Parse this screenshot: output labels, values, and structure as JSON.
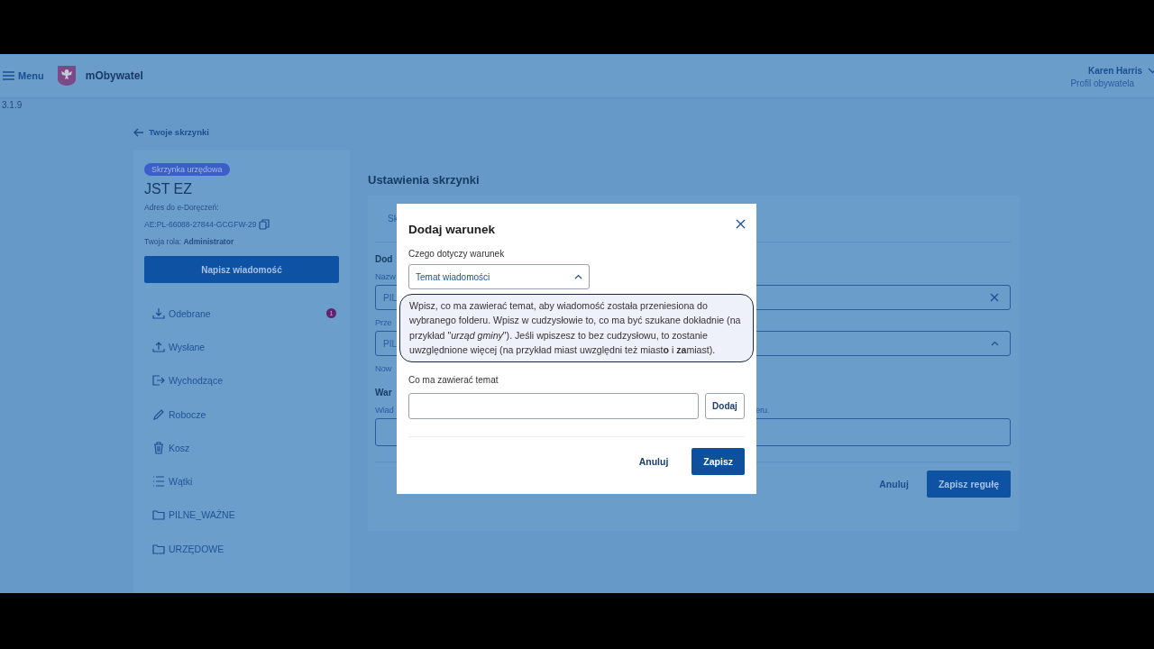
{
  "header": {
    "menu": "Menu",
    "app_name": "mObywatel",
    "user_name": "Karen Harris",
    "profile": "Profil obywatela"
  },
  "version": "3.1.9",
  "back_link": "Twoje skrzynki",
  "mailbox": {
    "badge": "Skrzynka urzędowa",
    "name": "JST EZ",
    "address_label": "Adres do e-Doręczeń:",
    "address": "AE:PL-66088-27844-GCGFW-29",
    "role": "Twoja rola: **Administrator**",
    "compose": "Napisz wiadomość"
  },
  "folders": [
    {
      "label": "Odebrane",
      "kind": "inbox",
      "count": "1"
    },
    {
      "label": "Wysłane",
      "kind": "sent"
    },
    {
      "label": "Wychodzące",
      "kind": "outbox"
    },
    {
      "label": "Robocze",
      "kind": "drafts"
    },
    {
      "label": "Kosz",
      "kind": "trash"
    },
    {
      "label": "Wątki",
      "kind": "threads"
    },
    {
      "label": "PILNE_WAŻNE",
      "kind": "folder"
    },
    {
      "label": "URZĘDOWE",
      "kind": "folder"
    }
  ],
  "settings": {
    "title": "Ustawienia skrzynki",
    "tab": "Sk",
    "section_1": "Dod",
    "name_label": "Nazw",
    "name_value": "PIL",
    "target_label": "Prze",
    "target_value": "PIL",
    "hint": "Now",
    "section_2": "War",
    "desc_start": "Wiad",
    "desc_end": "eru.",
    "cancel": "Anuluj",
    "save": "Zapisz regułę"
  },
  "dialog": {
    "title": "Dodaj warunek",
    "field_label": "Czego dotyczy warunek",
    "field_value": "Temat wiadomości",
    "info": "Wpisz, co ma zawierać temat, aby wiadomość została przeniesiona do wybranego folderu. Wpisz w cudzysłowie to, co ma być szukane dokładnie (na przykład \"*urząd gminy*\"). Jeśli wpiszesz to bez cudzysłowu, to zostanie uwzględnione więcej (na przykład miast uwzględni też miast**o** i **za**miast).",
    "input_label": "Co ma zawierać temat",
    "add": "Dodaj",
    "cancel": "Anuluj",
    "save": "Zapisz"
  }
}
